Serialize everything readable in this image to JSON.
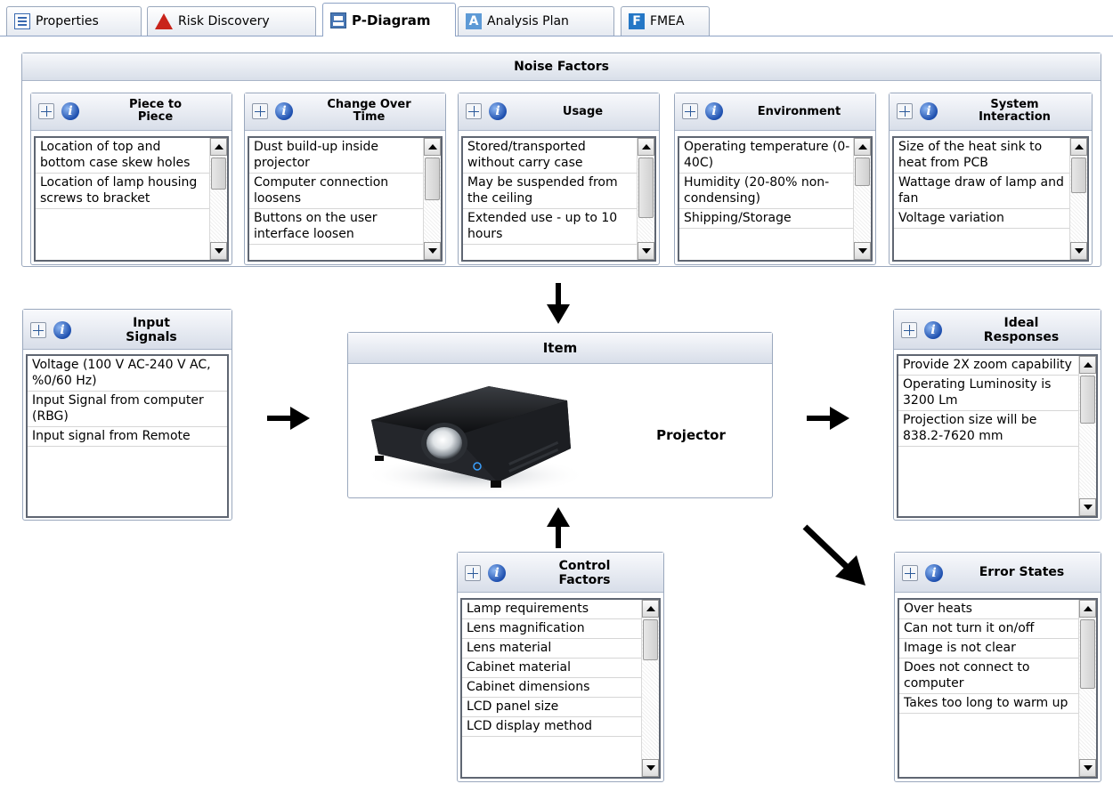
{
  "tabs": [
    {
      "label": "Properties",
      "icon": "properties-icon"
    },
    {
      "label": "Risk Discovery",
      "icon": "warning-icon"
    },
    {
      "label": "P-Diagram",
      "icon": "p-diagram-icon",
      "active": true
    },
    {
      "label": "Analysis Plan",
      "icon": "analysis-plan-icon",
      "glyph": "A"
    },
    {
      "label": "FMEA",
      "icon": "fmea-icon",
      "glyph": "F"
    }
  ],
  "noise_factors": {
    "title": "Noise Factors",
    "panels": [
      {
        "title": "Piece to\nPiece",
        "items": [
          "Location of top and bottom case skew holes",
          "Location of lamp housing screws to bracket"
        ]
      },
      {
        "title": "Change Over\nTime",
        "items": [
          "Dust build-up inside projector",
          "Computer connection loosens",
          "Buttons on the user interface loosen"
        ]
      },
      {
        "title": "Usage",
        "items": [
          "Stored/transported without carry case",
          "May be suspended from the ceiling",
          "Extended use - up to 10 hours"
        ]
      },
      {
        "title": "Environment",
        "items": [
          "Operating temperature (0-40C)",
          "Humidity (20-80% non-condensing)",
          "Shipping/Storage"
        ]
      },
      {
        "title": "System\nInteraction",
        "items": [
          "Size of the heat sink to heat from PCB",
          "Wattage draw of lamp and fan",
          "Voltage variation"
        ]
      }
    ]
  },
  "input_signals": {
    "title": "Input\nSignals",
    "items": [
      "Voltage (100 V AC-240 V AC, %0/60 Hz)",
      "Input Signal from computer (RBG)",
      "Input signal from Remote"
    ]
  },
  "item": {
    "title": "Item",
    "name": "Projector"
  },
  "ideal_responses": {
    "title": "Ideal\nResponses",
    "items": [
      "Provide 2X zoom capability",
      "Operating Luminosity is 3200 Lm",
      "Projection size will be 838.2-7620 mm"
    ]
  },
  "control_factors": {
    "title": "Control\nFactors",
    "items": [
      "Lamp requirements",
      "Lens magnification",
      "Lens material",
      "Cabinet material",
      "Cabinet dimensions",
      "LCD panel size",
      "LCD display method"
    ]
  },
  "error_states": {
    "title": "Error States",
    "items": [
      "Over heats",
      "Can not turn it on/off",
      "Image is not clear",
      "Does not connect to computer",
      "Takes too long to warm up"
    ]
  },
  "icons": {
    "move": "move-icon",
    "info": "info-icon"
  },
  "colors": {
    "header_gradient_top": "#f8f9fc",
    "header_gradient_bottom": "#d8dee9",
    "border": "#9aa8bd",
    "info_blue": "#1e4fae",
    "warning_red": "#c9241b"
  }
}
